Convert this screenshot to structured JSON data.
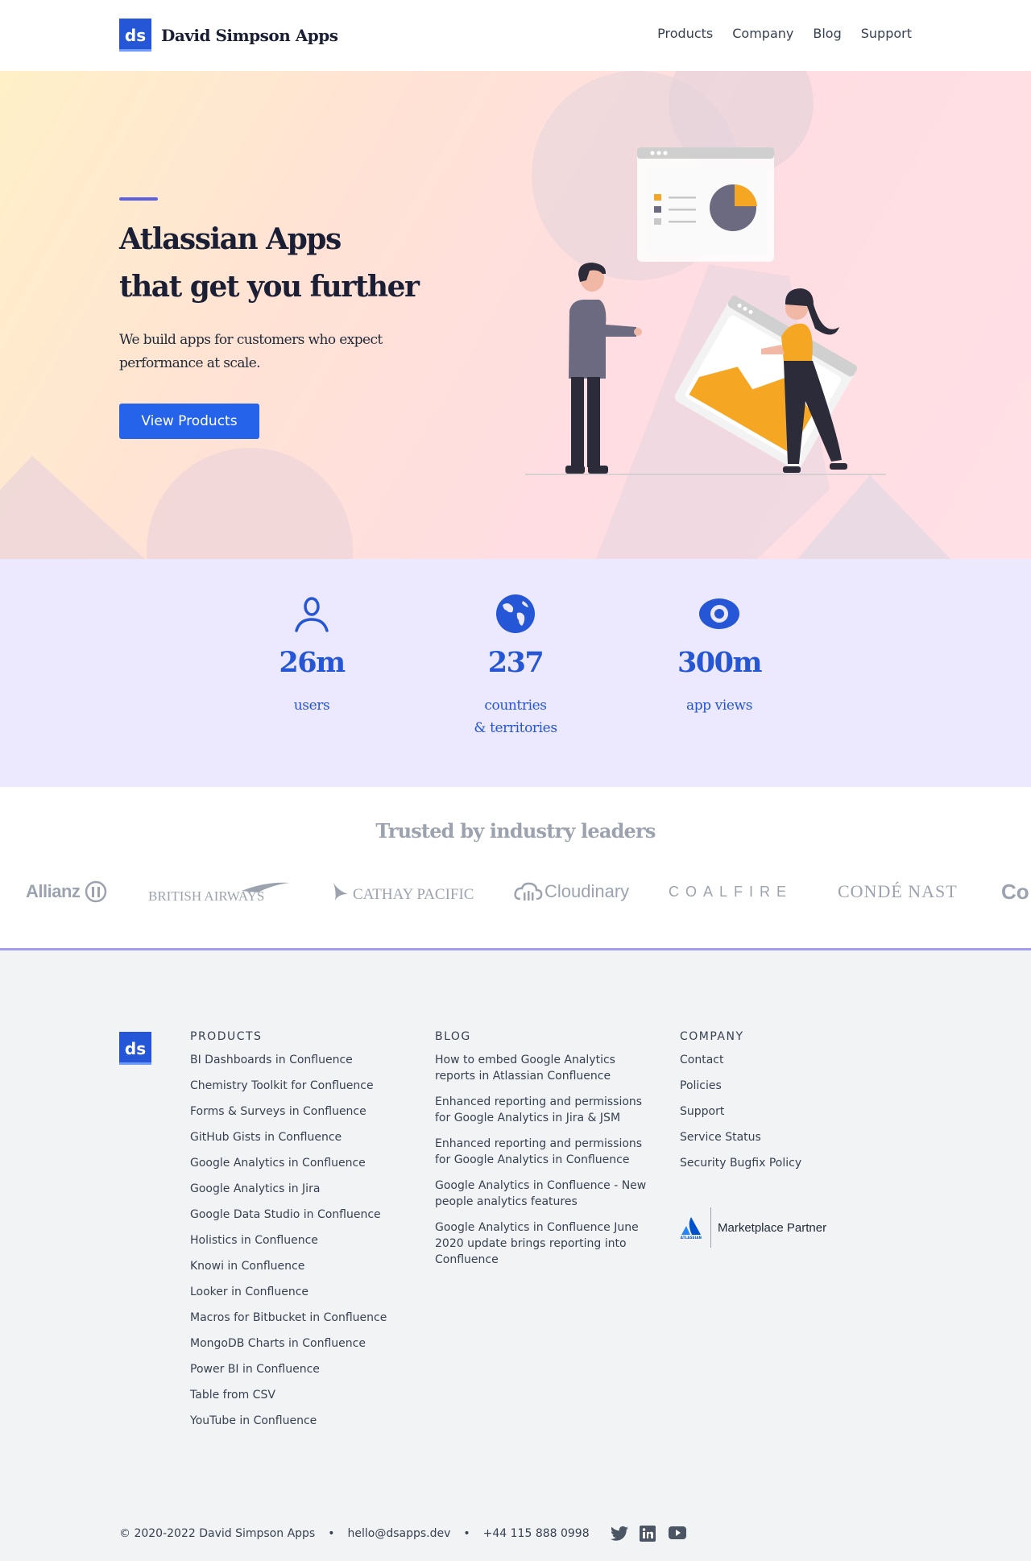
{
  "header": {
    "logo_text": "ds",
    "brand_name": "David Simpson Apps",
    "nav": [
      "Products",
      "Company",
      "Blog",
      "Support"
    ]
  },
  "hero": {
    "title_line1": "Atlassian Apps",
    "title_line2": "that get you further",
    "subtitle": "We build apps for customers who expect performance at scale.",
    "cta_label": "View Products"
  },
  "stats": [
    {
      "icon": "user-icon",
      "value": "26m",
      "label_line1": "users",
      "label_line2": ""
    },
    {
      "icon": "globe-icon",
      "value": "237",
      "label_line1": "countries",
      "label_line2": "& territories"
    },
    {
      "icon": "eye-icon",
      "value": "300m",
      "label_line1": "app views",
      "label_line2": ""
    }
  ],
  "trusted": {
    "title": "Trusted by industry leaders",
    "logos": [
      "Allianz",
      "BRITISH AIRWAYS",
      "CATHAY PACIFIC",
      "Cloudinary",
      "COALFIRE",
      "CONDÉ NAST",
      "Co"
    ]
  },
  "footer": {
    "logo_text": "ds",
    "products_heading": "PRODUCTS",
    "products": [
      "BI Dashboards in Confluence",
      "Chemistry Toolkit for Confluence",
      "Forms & Surveys in Confluence",
      "GitHub Gists in Confluence",
      "Google Analytics in Confluence",
      "Google Analytics in Jira",
      "Google Data Studio in Confluence",
      "Holistics in Confluence",
      "Knowi in Confluence",
      "Looker in Confluence",
      "Macros for Bitbucket in Confluence",
      "MongoDB Charts in Confluence",
      "Power BI in Confluence",
      "Table from CSV",
      "YouTube in Confluence"
    ],
    "blog_heading": "BLOG",
    "blog": [
      "How to embed Google Analytics reports in Atlassian Confluence",
      "Enhanced reporting and permissions for Google Analytics in Jira & JSM",
      "Enhanced reporting and permissions for Google Analytics in Confluence",
      "Google Analytics in Confluence - New people analytics features",
      "Google Analytics in Confluence June 2020 update brings reporting into Confluence"
    ],
    "company_heading": "COMPANY",
    "company": [
      "Contact",
      "Policies",
      "Support",
      "Service Status",
      "Security Bugfix Policy"
    ],
    "marketplace_small": "ATLASSIAN",
    "marketplace_label": "Marketplace Partner",
    "copyright": "© 2020-2022 David Simpson Apps",
    "email": "hello@dsapps.dev",
    "phone": "+44 115 888 0998",
    "social": [
      "twitter-icon",
      "linkedin-icon",
      "youtube-icon"
    ]
  },
  "colors": {
    "brand_blue": "#2456d6",
    "button_blue": "#2563eb",
    "accent_purple": "#5a60e0",
    "stats_bg": "#ece8fd",
    "footer_bg": "#f2f3f5",
    "illustration_orange": "#f5a623"
  }
}
